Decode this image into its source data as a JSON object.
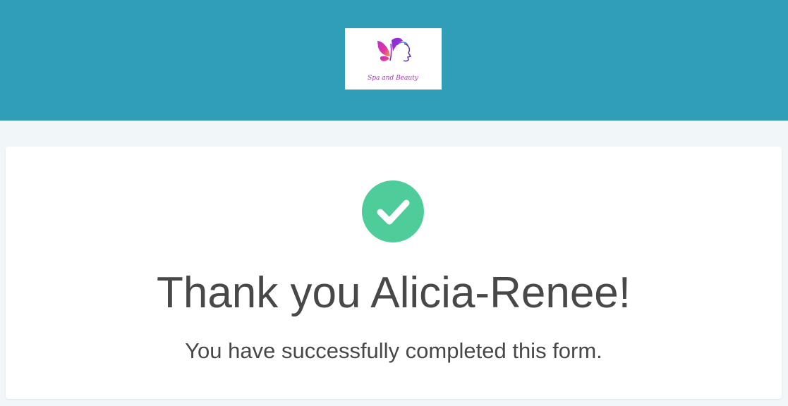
{
  "header": {
    "background_color": "#309eb7",
    "logo": {
      "icon": "butterfly-face-logo-icon",
      "text": "Spa and Beauty"
    }
  },
  "confirmation": {
    "icon": "check-circle-icon",
    "icon_color": "#4ecc9a",
    "title": "Thank you Alicia-Renee!",
    "message": "You have successfully completed this form."
  }
}
